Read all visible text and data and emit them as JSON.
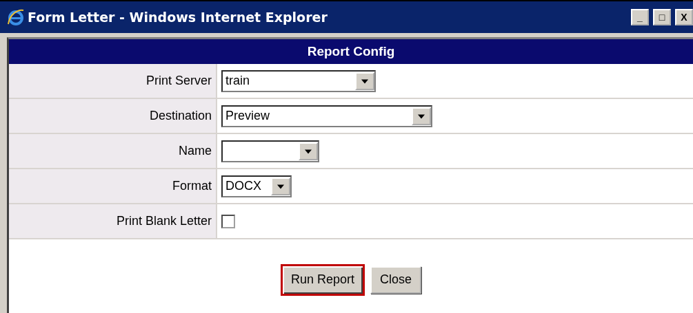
{
  "window": {
    "title": "Form Letter - Windows Internet Explorer",
    "controls": [
      "_",
      "□",
      "X"
    ]
  },
  "header": "Report Config",
  "fields": [
    {
      "kind": "select",
      "label": "Print Server",
      "value": "train"
    },
    {
      "kind": "select",
      "label": "Destination",
      "value": "Preview"
    },
    {
      "kind": "select",
      "label": "Name"
    },
    {
      "kind": "select",
      "label": "Format",
      "value": "DOCX"
    },
    {
      "kind": "checkbox",
      "label": "Print Blank Letter",
      "checked": false
    }
  ],
  "buttons": [
    {
      "label": "Run Report",
      "focused": true
    },
    {
      "label": "Close",
      "focused": false
    }
  ]
}
